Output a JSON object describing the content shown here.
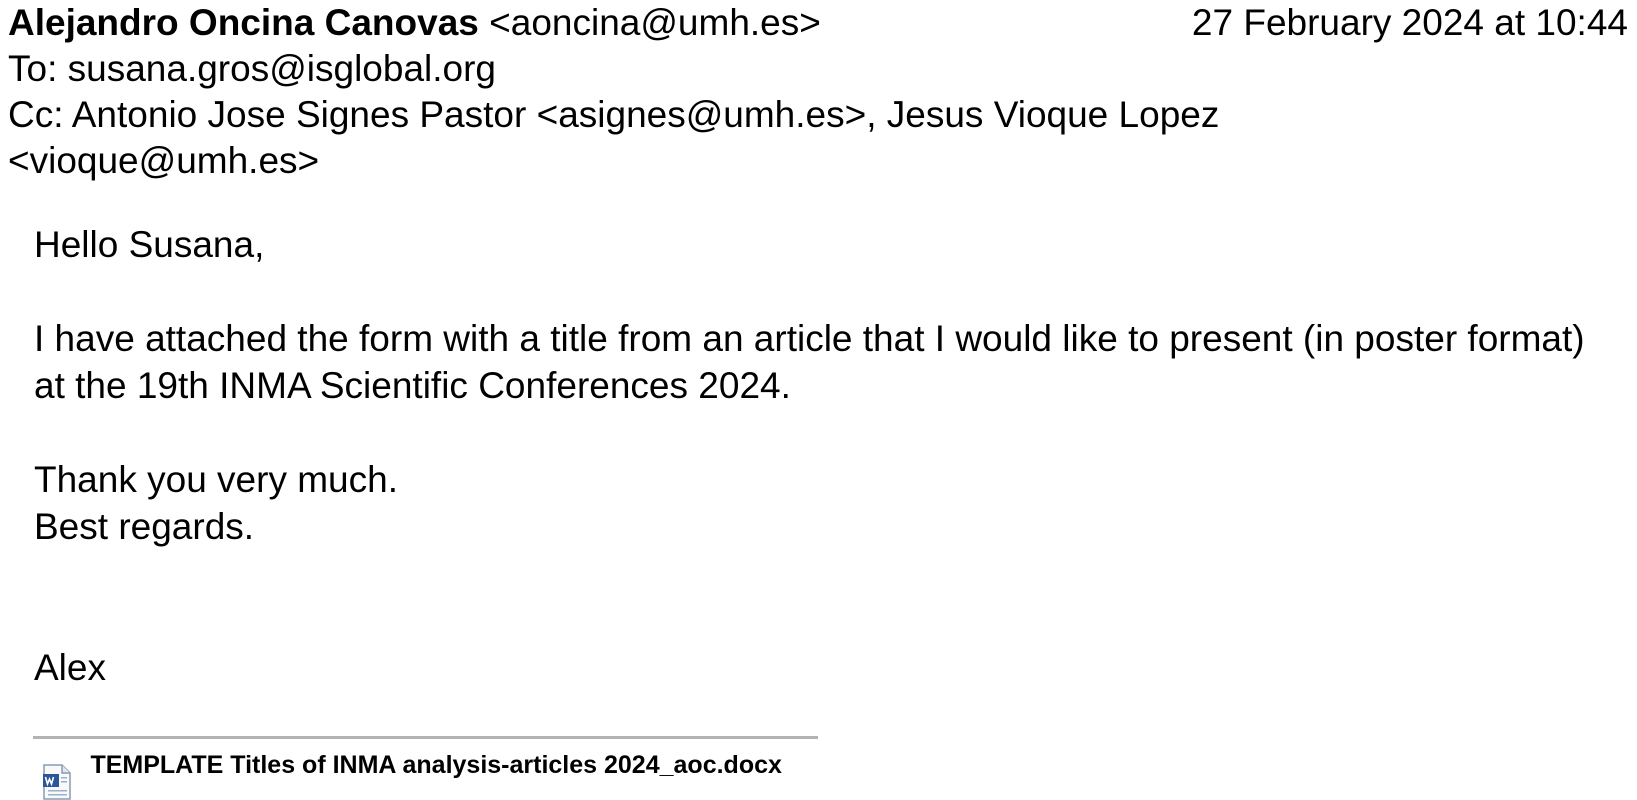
{
  "header": {
    "sender_name": "Alejandro Oncina Canovas",
    "sender_email": "<aoncina@umh.es>",
    "date": "27 February 2024 at 10:44",
    "to_label": "To:",
    "to_value": "susana.gros@isglobal.org",
    "cc_label": "Cc:",
    "cc_value": "Antonio Jose Signes Pastor <asignes@umh.es>, Jesus Vioque Lopez <vioque@umh.es>"
  },
  "body": {
    "greeting": "Hello Susana,",
    "paragraph": "I have attached the form with a title from an article that I would like to present (in poster format) at the 19th INMA Scientific Conferences 2024.",
    "thanks": "Thank you very much.",
    "closing": "Best regards.",
    "signature": "Alex"
  },
  "attachment": {
    "icon": "word-document-icon",
    "filename": "TEMPLATE Titles of INMA analysis-articles 2024_aoc.docx"
  }
}
